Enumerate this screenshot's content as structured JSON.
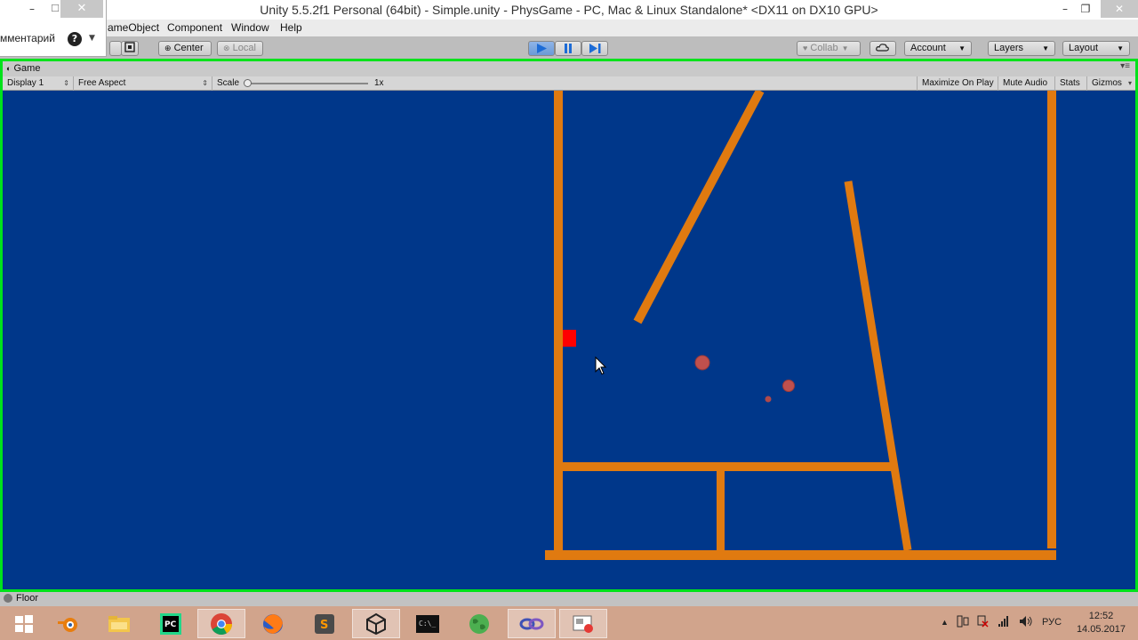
{
  "window": {
    "title": "Unity 5.5.2f1 Personal (64bit) - Simple.unity - PhysGame - PC, Mac & Linux Standalone* <DX11 on DX10 GPU>",
    "minimize": "–",
    "restore": "❐",
    "close": "✕"
  },
  "popup": {
    "minimize": "–",
    "maximize": "☐",
    "close": "✕",
    "comment_label": "мментарий",
    "help": "?",
    "dropdown_arrow": "▼"
  },
  "menu": [
    "ameObject",
    "Component",
    "Window",
    "Help"
  ],
  "toolbar": {
    "pivot_center": "Center",
    "pivot_local": "Local",
    "collab": "Collab",
    "account": "Account",
    "layers": "Layers",
    "layout": "Layout",
    "play_icon": "play-icon",
    "pause_icon": "pause-icon",
    "step_icon": "step-icon"
  },
  "game_panel": {
    "tab_label": "Game",
    "display": "Display 1",
    "aspect": "Free Aspect",
    "scale_label": "Scale",
    "scale_value": "1x",
    "maximize_on_play": "Maximize On Play",
    "mute_audio": "Mute Audio",
    "stats": "Stats",
    "gizmos": "Gizmos",
    "background_color": "#00378a",
    "object_color": "#e07a10",
    "player_color": "#ff0000",
    "ball_color": "#c0504d"
  },
  "status": {
    "message": "Floor"
  },
  "taskbar": {
    "apps": [
      "windows-start-icon",
      "blender-icon",
      "file-explorer-icon",
      "pycharm-icon",
      "chrome-icon",
      "firefox-icon",
      "sublime-icon",
      "unity-icon",
      "terminal-icon",
      "globe-icon",
      "link-app-icon",
      "screen-recorder-icon"
    ],
    "active_app": "unity-icon",
    "language": "РУС",
    "time": "12:52",
    "date": "14.05.2017"
  }
}
